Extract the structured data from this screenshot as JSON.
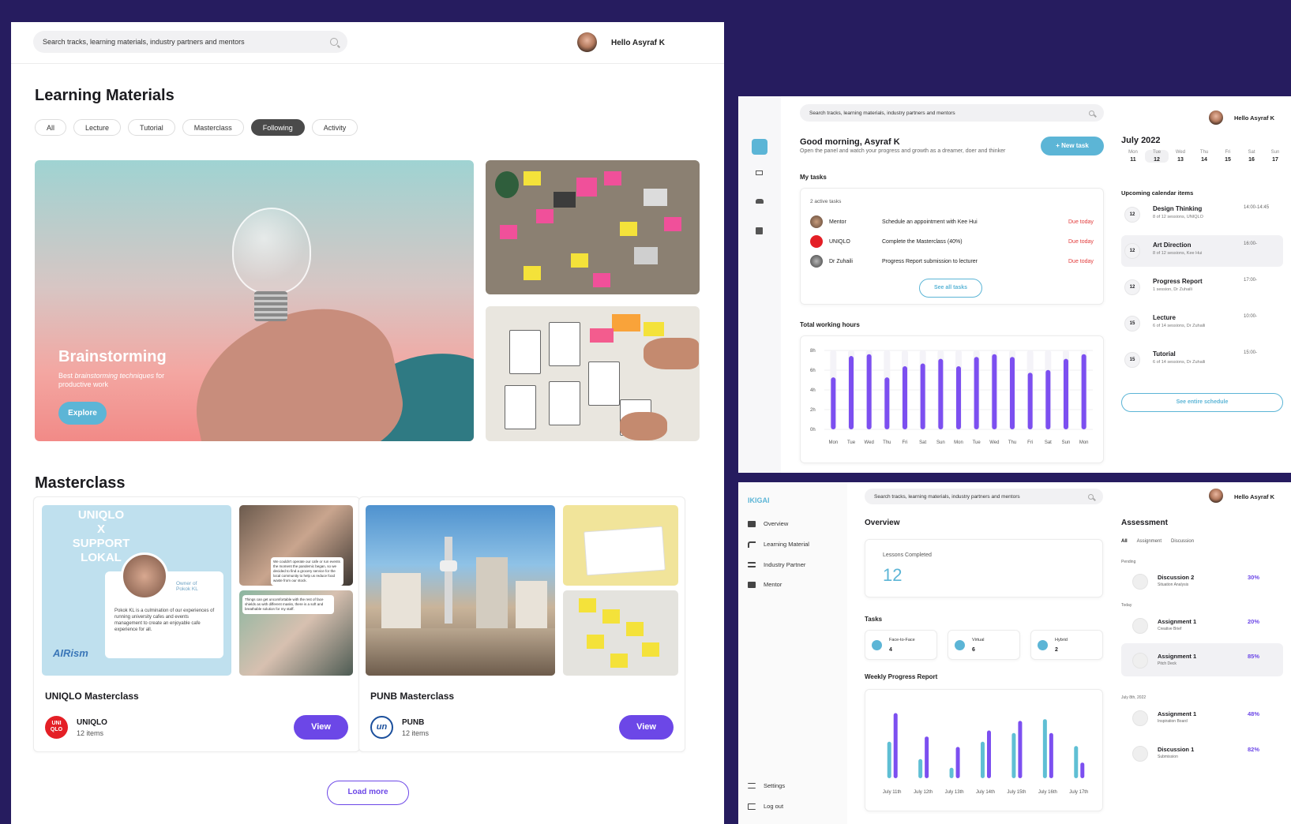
{
  "search": {
    "placeholder": "Search tracks, learning materials, industry partners and mentors"
  },
  "user": {
    "greeting": "Hello Asyraf K"
  },
  "learning": {
    "title": "Learning Materials",
    "filters": [
      "All",
      "Lecture",
      "Tutorial",
      "Masterclass",
      "Following",
      "Activity"
    ],
    "active_filter": "Following",
    "hero": {
      "title": "Brainstorming",
      "subtitle_pre": "Best ",
      "subtitle_em": "brainstorming techniques",
      "subtitle_post": " for productive work",
      "button": "Explore"
    }
  },
  "masterclass": {
    "title": "Masterclass",
    "cards": [
      {
        "title": "UNIQLO Masterclass",
        "partner": "UNIQLO",
        "count": "12 items",
        "button": "View",
        "logo_text": "UNI QLO",
        "image_text": [
          "UNIQLO",
          "X",
          "SUPPORT",
          "LOKAL"
        ],
        "image_caption": "Owner of Pokok KL",
        "image_quote": "Pokok KL is a culmination of our experiences of running university cafes and events management to create an enjoyable cafe experience for all.",
        "image_brand": "AIRism",
        "bubble_1": "We couldn't operate our cafe or run events the moment the pandemic began, so we decided to find a grocery service for the local community to help us reduce food waste from our stock.",
        "bubble_2": "Things can get uncomfortable with the rest of face shields as with different masks, there is a soft and breathable solution for my staff."
      },
      {
        "title": "PUNB Masterclass",
        "partner": "PUNB",
        "count": "12 items",
        "button": "View",
        "logo_text": "un"
      }
    ],
    "load_more": "Load more"
  },
  "dashboard": {
    "greeting": "Good morning, Asyraf K",
    "subtitle": "Open the panel and watch your progress and growth as a dreamer, doer and thinker",
    "new_task": "+ New task",
    "my_tasks_label": "My tasks",
    "active_tasks": "2 active tasks",
    "tasks": [
      {
        "who": "Mentor",
        "what": "Schedule an appointment with Kee Hui",
        "due": "Due today"
      },
      {
        "who": "UNIQLO",
        "what": "Complete the Masterclass (40%)",
        "due": "Due today"
      },
      {
        "who": "Dr Zuhaili",
        "what": "Progress Report submission to lecturer",
        "due": "Due today"
      }
    ],
    "see_all": "See all tasks",
    "hours_label": "Total working hours",
    "calendar": {
      "month": "July 2022",
      "days": [
        {
          "d": "Mon",
          "n": "11"
        },
        {
          "d": "Tue",
          "n": "12"
        },
        {
          "d": "Wed",
          "n": "13"
        },
        {
          "d": "Thu",
          "n": "14"
        },
        {
          "d": "Fri",
          "n": "15"
        },
        {
          "d": "Sat",
          "n": "16"
        },
        {
          "d": "Sun",
          "n": "17"
        }
      ],
      "selected_day": "12",
      "upcoming_label": "Upcoming calendar items",
      "items": [
        {
          "num": "12",
          "name": "Design Thinking",
          "meta": "8 of 12 sessions, UNIQLO",
          "time": "14:00-14:45"
        },
        {
          "num": "12",
          "name": "Art Direction",
          "meta": "8 of 12 sessions, Kee Hui",
          "time": "16:00-"
        },
        {
          "num": "12",
          "name": "Progress Report",
          "meta": "1 session, Dr Zuhaili",
          "time": "17:00-"
        },
        {
          "num": "15",
          "name": "Lecture",
          "meta": "6 of 14 sessions, Dr Zuhaili",
          "time": "10:00-"
        },
        {
          "num": "15",
          "name": "Tutorial",
          "meta": "6 of 14 sessions, Dr Zuhaili",
          "time": "15:00-"
        }
      ],
      "see_schedule": "See entire schedule"
    }
  },
  "ikigai": {
    "brand": "IKIGAI",
    "nav": [
      "Overview",
      "Learning Material",
      "Industry Partner",
      "Mentor"
    ],
    "nav_bottom": [
      "Settings",
      "Log out"
    ],
    "overview_title": "Overview",
    "lessons_label": "Lessons Completed",
    "lessons_value": "12",
    "tasks_label": "Tasks",
    "modes": [
      {
        "label": "Face-to-Face",
        "value": "4"
      },
      {
        "label": "Virtual",
        "value": "6"
      },
      {
        "label": "Hybrid",
        "value": "2"
      }
    ],
    "weekly_label": "Weekly Progress Report",
    "assessment": {
      "title": "Assessment",
      "tabs": [
        "All",
        "Assignment",
        "Discussion"
      ],
      "groups": [
        "Pending",
        "Today",
        "July 8th, 2022"
      ],
      "items": [
        {
          "name": "Discussion 2",
          "sub": "Situation Analysis",
          "pct": "30%"
        },
        {
          "name": "Assignment 1",
          "sub": "Creative Brief",
          "pct": "20%"
        },
        {
          "name": "Assignment 1",
          "sub": "Pitch Deck",
          "pct": "85%"
        },
        {
          "name": "Assignment 1",
          "sub": "Inspiration Board",
          "pct": "48%"
        },
        {
          "name": "Discussion 1",
          "sub": "Submission",
          "pct": "82%"
        }
      ]
    }
  },
  "colors": {
    "accent": "#6c47e7",
    "teal": "#5cb5d6",
    "background": "#261c5f",
    "due": "#e23b3b"
  },
  "icons": {
    "search": "search-icon",
    "dashboard_home": "grid-icon",
    "nav_tracks": "share-icon",
    "nav_people": "users-icon",
    "nav_calendar": "calendar-icon"
  },
  "chart_data": [
    {
      "type": "bar",
      "title": "Total working hours",
      "categories": [
        "Mon",
        "Tue",
        "Wed",
        "Thu",
        "Fri",
        "Sat",
        "Sun",
        "Mon",
        "Tue",
        "Wed",
        "Thu",
        "Fri",
        "Sat",
        "Sun",
        "Mon"
      ],
      "values": [
        5.6,
        7.9,
        8.1,
        5.6,
        6.8,
        7.1,
        7.6,
        6.8,
        7.8,
        8.1,
        7.8,
        6.1,
        6.4,
        7.6,
        8.1
      ],
      "yticks": [
        "8h",
        "6h",
        "4h",
        "2h",
        "0h"
      ],
      "ylim": [
        0,
        8.5
      ]
    },
    {
      "type": "bar",
      "title": "Weekly Progress Report",
      "categories": [
        "July 11th",
        "July 12th",
        "July 13th",
        "July 14th",
        "July 15th",
        "July 16th",
        "July 17th"
      ],
      "series": [
        {
          "values": [
            42,
            22,
            12,
            42,
            52,
            68,
            37
          ]
        },
        {
          "values": [
            75,
            48,
            36,
            55,
            66,
            52,
            18
          ]
        }
      ],
      "ylim": [
        0,
        80
      ]
    }
  ]
}
